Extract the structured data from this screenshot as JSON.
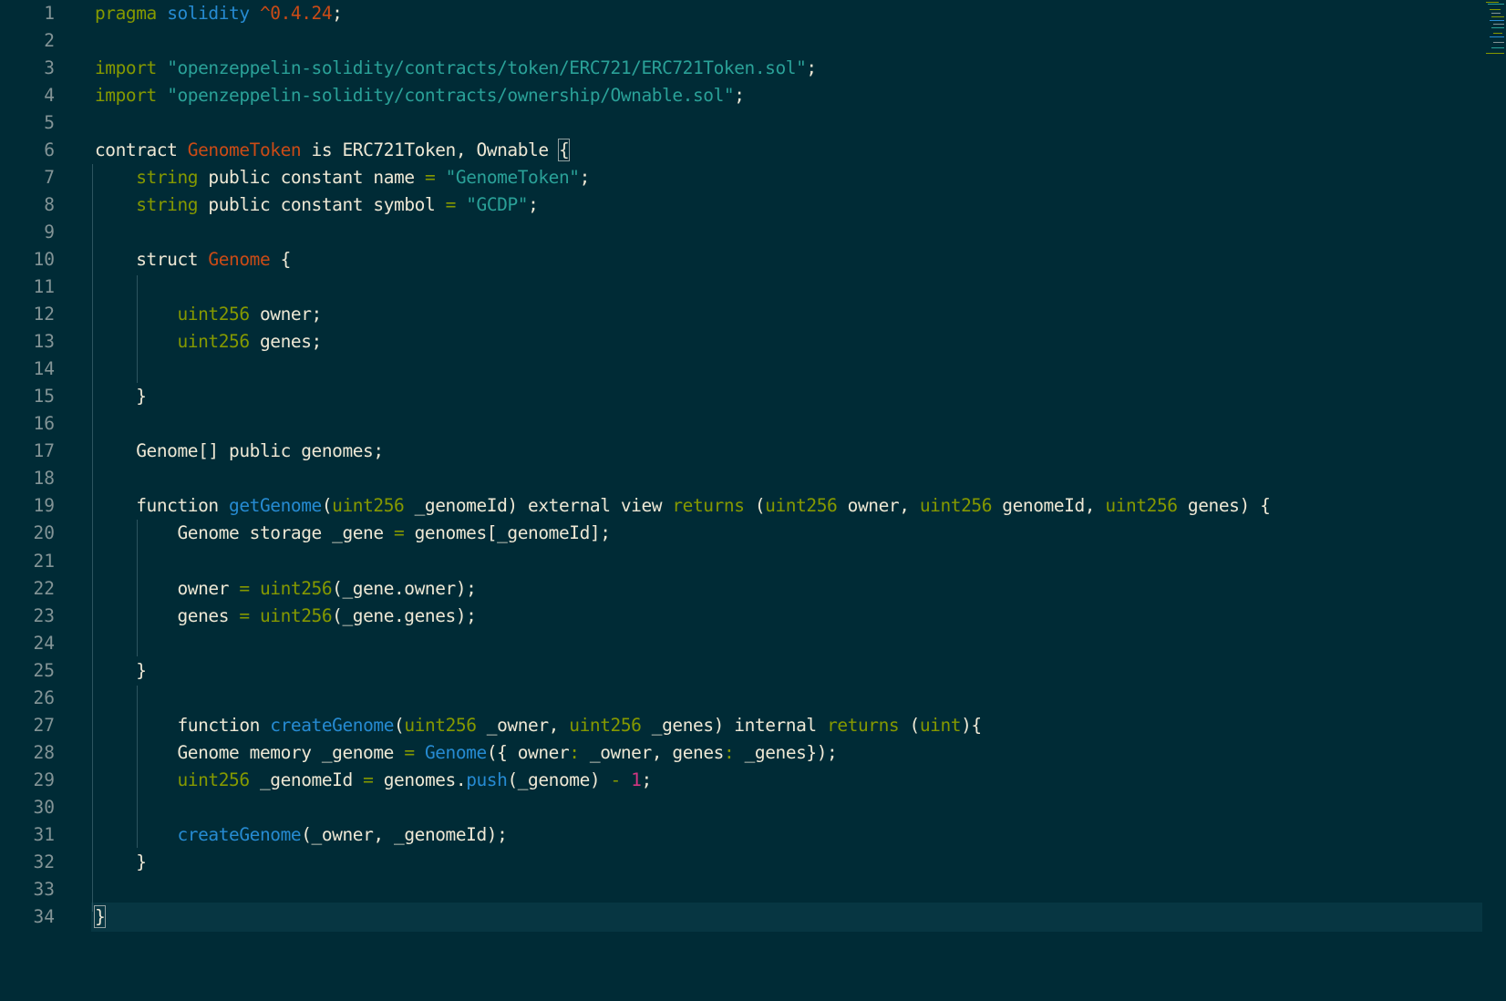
{
  "editor": {
    "language": "solidity",
    "colors": {
      "background": "#002b36",
      "current_line": "#073642",
      "keyword": "#859900",
      "type": "#268bd2",
      "entity": "#cb4b16",
      "string": "#2aa198",
      "text": "#eee8d5",
      "number": "#d33682",
      "line_number": "#839496"
    },
    "lines": [
      {
        "n": "1",
        "tokens": [
          [
            "pragma",
            "green"
          ],
          [
            " ",
            "white"
          ],
          [
            "solidity",
            "blue"
          ],
          [
            " ",
            "white"
          ],
          [
            "^0.4.24",
            "orange"
          ],
          [
            ";",
            "white"
          ]
        ]
      },
      {
        "n": "2",
        "tokens": []
      },
      {
        "n": "3",
        "tokens": [
          [
            "import",
            "green"
          ],
          [
            " ",
            "white"
          ],
          [
            "\"openzeppelin-solidity/contracts/token/ERC721/ERC721Token.sol\"",
            "cyan"
          ],
          [
            ";",
            "white"
          ]
        ]
      },
      {
        "n": "4",
        "tokens": [
          [
            "import",
            "green"
          ],
          [
            " ",
            "white"
          ],
          [
            "\"openzeppelin-solidity/contracts/ownership/Ownable.sol\"",
            "cyan"
          ],
          [
            ";",
            "white"
          ]
        ]
      },
      {
        "n": "5",
        "tokens": []
      },
      {
        "n": "6",
        "tokens": [
          [
            "contract",
            "white"
          ],
          [
            " ",
            "white"
          ],
          [
            "GenomeToken",
            "orange"
          ],
          [
            " is ERC721Token, Ownable ",
            "white"
          ],
          [
            "{",
            "white",
            "box"
          ]
        ]
      },
      {
        "n": "7",
        "tokens": [
          [
            "    ",
            "white"
          ],
          [
            "string",
            "green"
          ],
          [
            " public constant name ",
            "white"
          ],
          [
            "=",
            "green"
          ],
          [
            " ",
            "white"
          ],
          [
            "\"GenomeToken\"",
            "cyan"
          ],
          [
            ";",
            "white"
          ]
        ]
      },
      {
        "n": "8",
        "tokens": [
          [
            "    ",
            "white"
          ],
          [
            "string",
            "green"
          ],
          [
            " public constant symbol ",
            "white"
          ],
          [
            "=",
            "green"
          ],
          [
            " ",
            "white"
          ],
          [
            "\"GCDP\"",
            "cyan"
          ],
          [
            ";",
            "white"
          ]
        ]
      },
      {
        "n": "9",
        "tokens": []
      },
      {
        "n": "10",
        "tokens": [
          [
            "    struct ",
            "white"
          ],
          [
            "Genome",
            "orange"
          ],
          [
            " {",
            "white"
          ]
        ]
      },
      {
        "n": "11",
        "tokens": []
      },
      {
        "n": "12",
        "tokens": [
          [
            "        ",
            "white"
          ],
          [
            "uint256",
            "green"
          ],
          [
            " owner;",
            "white"
          ]
        ]
      },
      {
        "n": "13",
        "tokens": [
          [
            "        ",
            "white"
          ],
          [
            "uint256",
            "green"
          ],
          [
            " genes;",
            "white"
          ]
        ]
      },
      {
        "n": "14",
        "tokens": []
      },
      {
        "n": "15",
        "tokens": [
          [
            "    }",
            "white"
          ]
        ]
      },
      {
        "n": "16",
        "tokens": []
      },
      {
        "n": "17",
        "tokens": [
          [
            "    Genome[] public genomes;",
            "white"
          ]
        ]
      },
      {
        "n": "18",
        "tokens": []
      },
      {
        "n": "19",
        "tokens": [
          [
            "    function ",
            "white"
          ],
          [
            "getGenome",
            "blue"
          ],
          [
            "(",
            "white"
          ],
          [
            "uint256",
            "green"
          ],
          [
            " _genomeId) external view ",
            "white"
          ],
          [
            "returns",
            "green"
          ],
          [
            " (",
            "white"
          ],
          [
            "uint256",
            "green"
          ],
          [
            " owner, ",
            "white"
          ],
          [
            "uint256",
            "green"
          ],
          [
            " genomeId, ",
            "white"
          ],
          [
            "uint256",
            "green"
          ],
          [
            " genes) {",
            "white"
          ]
        ]
      },
      {
        "n": "20",
        "tokens": [
          [
            "        Genome storage _gene ",
            "white"
          ],
          [
            "=",
            "green"
          ],
          [
            " genomes[_genomeId];",
            "white"
          ]
        ]
      },
      {
        "n": "21",
        "tokens": []
      },
      {
        "n": "22",
        "tokens": [
          [
            "        owner ",
            "white"
          ],
          [
            "=",
            "green"
          ],
          [
            " ",
            "white"
          ],
          [
            "uint256",
            "green"
          ],
          [
            "(_gene.owner);",
            "white"
          ]
        ]
      },
      {
        "n": "23",
        "tokens": [
          [
            "        genes ",
            "white"
          ],
          [
            "=",
            "green"
          ],
          [
            " ",
            "white"
          ],
          [
            "uint256",
            "green"
          ],
          [
            "(_gene.genes);",
            "white"
          ]
        ]
      },
      {
        "n": "24",
        "tokens": []
      },
      {
        "n": "25",
        "tokens": [
          [
            "    }",
            "white"
          ]
        ]
      },
      {
        "n": "26",
        "tokens": []
      },
      {
        "n": "27",
        "tokens": [
          [
            "        function ",
            "white"
          ],
          [
            "createGenome",
            "blue"
          ],
          [
            "(",
            "white"
          ],
          [
            "uint256",
            "green"
          ],
          [
            " _owner, ",
            "white"
          ],
          [
            "uint256",
            "green"
          ],
          [
            " _genes) internal ",
            "white"
          ],
          [
            "returns",
            "green"
          ],
          [
            " (",
            "white"
          ],
          [
            "uint",
            "green"
          ],
          [
            "){",
            "white"
          ]
        ]
      },
      {
        "n": "28",
        "tokens": [
          [
            "        Genome memory _genome ",
            "white"
          ],
          [
            "=",
            "green"
          ],
          [
            " ",
            "white"
          ],
          [
            "Genome",
            "blue"
          ],
          [
            "({ owner",
            "white"
          ],
          [
            ":",
            "green"
          ],
          [
            " _owner, genes",
            "white"
          ],
          [
            ":",
            "green"
          ],
          [
            " _genes});",
            "white"
          ]
        ]
      },
      {
        "n": "29",
        "tokens": [
          [
            "        ",
            "white"
          ],
          [
            "uint256",
            "green"
          ],
          [
            " _genomeId ",
            "white"
          ],
          [
            "=",
            "green"
          ],
          [
            " genomes.",
            "white"
          ],
          [
            "push",
            "blue"
          ],
          [
            "(_genome) ",
            "white"
          ],
          [
            "-",
            "green"
          ],
          [
            " ",
            "white"
          ],
          [
            "1",
            "magenta"
          ],
          [
            ";",
            "white"
          ]
        ]
      },
      {
        "n": "30",
        "tokens": []
      },
      {
        "n": "31",
        "tokens": [
          [
            "        ",
            "white"
          ],
          [
            "createGenome",
            "blue"
          ],
          [
            "(_owner, _genomeId);",
            "white"
          ]
        ]
      },
      {
        "n": "32",
        "tokens": [
          [
            "    }",
            "white"
          ]
        ]
      },
      {
        "n": "33",
        "tokens": []
      },
      {
        "n": "34",
        "tokens": [
          [
            "}",
            "white",
            "box"
          ]
        ]
      }
    ],
    "current_line": 34
  }
}
